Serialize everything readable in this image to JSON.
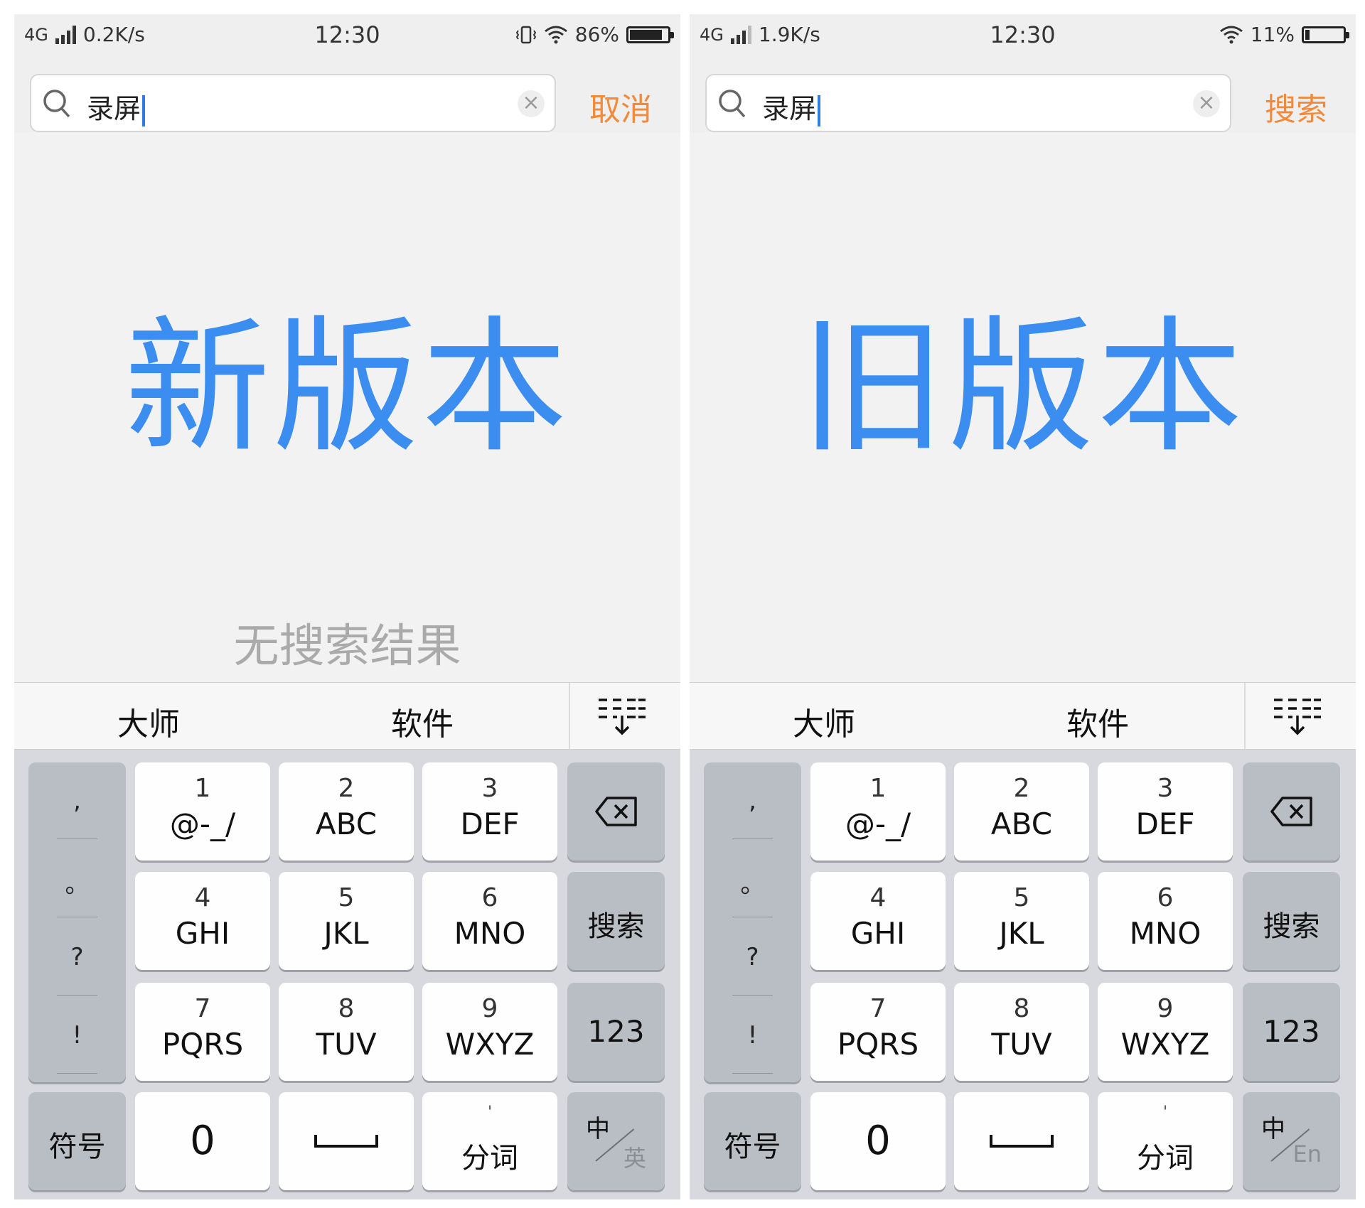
{
  "panels": [
    {
      "status": {
        "net": "4G",
        "speed": "0.2K/s",
        "time": "12:30",
        "battery": "86%",
        "battery_fill": 0.86
      },
      "search": {
        "query": "录屏",
        "action": "取消"
      },
      "version_label": "新版本",
      "no_result": "无搜索结果",
      "candidates": [
        "大师",
        "软件"
      ],
      "keys": {
        "punct": [
          ",",
          "。",
          "?",
          "!"
        ],
        "k1_num": "1",
        "k1_letters": "@-_/",
        "k2_num": "2",
        "k2_letters": "ABC",
        "k3_num": "3",
        "k3_letters": "DEF",
        "k4_num": "4",
        "k4_letters": "GHI",
        "k5_num": "5",
        "k5_letters": "JKL",
        "k6_num": "6",
        "k6_letters": "MNO",
        "k7_num": "7",
        "k7_letters": "PQRS",
        "k8_num": "8",
        "k8_letters": "TUV",
        "k9_num": "9",
        "k9_letters": "WXYZ",
        "search": "搜索",
        "num_mode": "123",
        "symbols": "符号",
        "zero": "0",
        "split_tick": "'",
        "split": "分词",
        "lang_zh": "中",
        "lang_other": "英"
      }
    },
    {
      "status": {
        "net": "4G",
        "speed": "1.9K/s",
        "time": "12:30",
        "battery": "11%",
        "battery_fill": 0.11
      },
      "search": {
        "query": "录屏",
        "action": "搜索"
      },
      "version_label": "旧版本",
      "no_result": "",
      "candidates": [
        "大师",
        "软件"
      ],
      "keys": {
        "punct": [
          ",",
          "。",
          "?",
          "!"
        ],
        "k1_num": "1",
        "k1_letters": "@-_/",
        "k2_num": "2",
        "k2_letters": "ABC",
        "k3_num": "3",
        "k3_letters": "DEF",
        "k4_num": "4",
        "k4_letters": "GHI",
        "k5_num": "5",
        "k5_letters": "JKL",
        "k6_num": "6",
        "k6_letters": "MNO",
        "k7_num": "7",
        "k7_letters": "PQRS",
        "k8_num": "8",
        "k8_letters": "TUV",
        "k9_num": "9",
        "k9_letters": "WXYZ",
        "search": "搜索",
        "num_mode": "123",
        "symbols": "符号",
        "zero": "0",
        "split_tick": "'",
        "split": "分词",
        "lang_zh": "中",
        "lang_other": "En"
      }
    }
  ],
  "colors": {
    "accent_blue": "#3b8df0",
    "action_orange": "#f08a3c",
    "muted_text": "#aaaaaa"
  },
  "icons": [
    "signal-icon",
    "vibrate-icon",
    "wifi-icon",
    "battery-icon",
    "search-icon",
    "clear-icon",
    "expand-candidates-icon",
    "backspace-icon"
  ]
}
